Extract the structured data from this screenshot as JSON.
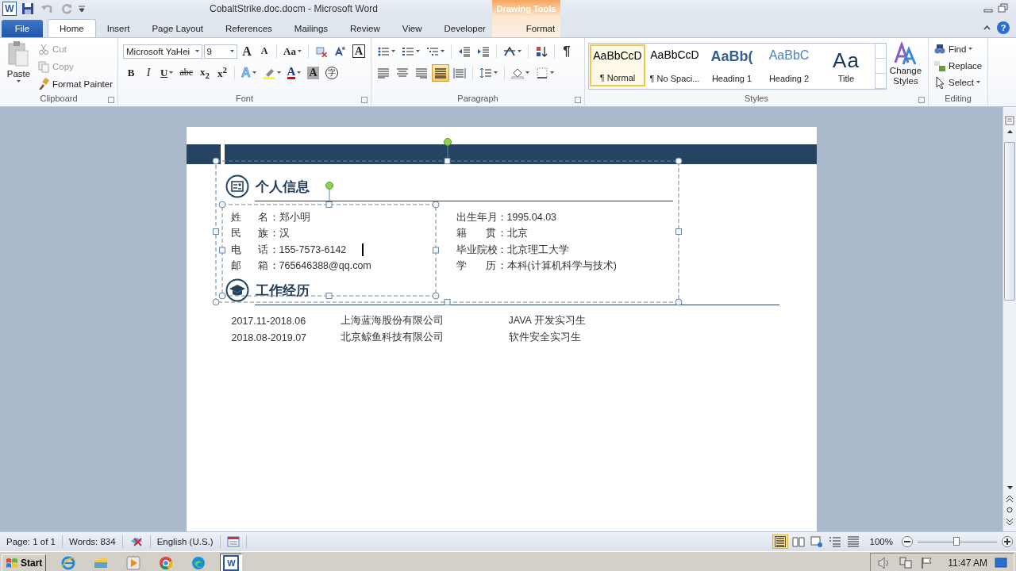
{
  "title_bar": {
    "app_icon": "W",
    "title": "CobaltStrike.doc.docm - Microsoft Word",
    "context_tab": "Drawing Tools",
    "help": "?"
  },
  "tabs": [
    {
      "label": "File",
      "kind": "file",
      "selected": false
    },
    {
      "label": "Home",
      "kind": "tab",
      "selected": true
    },
    {
      "label": "Insert",
      "kind": "tab",
      "selected": false
    },
    {
      "label": "Page Layout",
      "kind": "tab",
      "selected": false
    },
    {
      "label": "References",
      "kind": "tab",
      "selected": false
    },
    {
      "label": "Mailings",
      "kind": "tab",
      "selected": false
    },
    {
      "label": "Review",
      "kind": "tab",
      "selected": false
    },
    {
      "label": "View",
      "kind": "tab",
      "selected": false
    },
    {
      "label": "Developer",
      "kind": "tab",
      "selected": false
    },
    {
      "label": "Format",
      "kind": "context",
      "selected": false
    }
  ],
  "clipboard": {
    "label": "Clipboard",
    "paste": "Paste",
    "items": [
      {
        "kind": "cut",
        "label": "Cut",
        "disabled": true
      },
      {
        "kind": "copy",
        "label": "Copy",
        "disabled": true
      },
      {
        "kind": "brush",
        "label": "Format Painter",
        "disabled": false
      }
    ]
  },
  "font": {
    "label": "Font",
    "name": "Microsoft YaHei",
    "size": "9",
    "row1": [
      {
        "kind": "grow",
        "label": "A"
      },
      {
        "kind": "shrink",
        "label": "A"
      },
      {
        "kind": "case",
        "label": "Aa"
      },
      {
        "kind": "clear"
      },
      {
        "kind": "phonetic"
      },
      {
        "kind": "border",
        "label": "A"
      }
    ],
    "row2": [
      {
        "kind": "bold",
        "label": "B"
      },
      {
        "kind": "italic",
        "label": "I"
      },
      {
        "kind": "underline",
        "label": "U"
      },
      {
        "kind": "strike",
        "label": "abc"
      },
      {
        "kind": "sub",
        "label": "x$_{2}$"
      },
      {
        "kind": "sup",
        "label": "x$^{2}$"
      },
      {
        "kind": "effects",
        "label": "A"
      },
      {
        "kind": "highlight"
      },
      {
        "kind": "color",
        "label": "A"
      },
      {
        "kind": "shading",
        "label": "A"
      },
      {
        "kind": "enclose",
        "label": "字"
      }
    ]
  },
  "paragraph": {
    "label": "Paragraph",
    "row1": [
      {
        "kind": "bullets"
      },
      {
        "kind": "numbering"
      },
      {
        "kind": "multilevel"
      },
      {
        "kind": "outdent"
      },
      {
        "kind": "indent"
      },
      {
        "kind": "asian"
      },
      {
        "kind": "sort"
      },
      {
        "kind": "marks",
        "label": "¶"
      }
    ],
    "row2": [
      {
        "kind": "left",
        "selected": false
      },
      {
        "kind": "center",
        "selected": false
      },
      {
        "kind": "right",
        "selected": false
      },
      {
        "kind": "justify",
        "selected": true
      },
      {
        "kind": "distributed",
        "selected": false
      },
      {
        "kind": "spacing",
        "selected": false
      },
      {
        "kind": "fill",
        "selected": false
      },
      {
        "kind": "borders",
        "selected": false
      }
    ]
  },
  "styles": {
    "label": "Styles",
    "change": "Change Styles",
    "items": [
      {
        "sample": "AaBbCcD",
        "name": "¶ Normal",
        "kind": "normal",
        "selected": true
      },
      {
        "sample": "AaBbCcD",
        "name": "¶ No Spaci...",
        "kind": "normal",
        "selected": false
      },
      {
        "sample": "AaBb(",
        "name": "Heading 1",
        "kind": "heading1",
        "selected": false
      },
      {
        "sample": "AaBbC",
        "name": "Heading 2",
        "kind": "heading2",
        "selected": false
      },
      {
        "sample": "Aa",
        "name": "Title",
        "kind": "title",
        "selected": false
      }
    ]
  },
  "editing": {
    "label": "Editing",
    "items": [
      {
        "kind": "find",
        "label": "Find"
      },
      {
        "kind": "replace",
        "label": "Replace"
      },
      {
        "kind": "select",
        "label": "Select"
      }
    ]
  },
  "document": {
    "info": {
      "title": "个人信息",
      "selected": true,
      "left": {
        "selected": true,
        "fields": [
          {
            "label": "姓 名",
            "value": "：郑小明",
            "caret": false
          },
          {
            "label": "民 族",
            "value": "：汉",
            "caret": false
          },
          {
            "label": "电 话",
            "value": "：155-7573-6142",
            "caret": true
          },
          {
            "label": "邮 箱",
            "value": "：765646388@qq.com",
            "caret": false
          }
        ]
      },
      "right": {
        "fields": [
          {
            "label": "出生年月",
            "value": "：1995.04.03"
          },
          {
            "label": "籍 贯",
            "value": "：北京"
          },
          {
            "label": "毕业院校",
            "value": "：北京理工大学"
          },
          {
            "label": "学 历",
            "value": "：本科(计算机科学与技术)"
          }
        ]
      }
    },
    "work": {
      "title": "工作经历",
      "rows": [
        {
          "period": "2017.11-2018.06",
          "company": "上海蓝海股份有限公司",
          "role": "JAVA 开发实习生"
        },
        {
          "period": "2018.08-2019.07",
          "company": "北京鲸鱼科技有限公司",
          "role": "软件安全实习生"
        }
      ]
    }
  },
  "status_bar": {
    "page": "Page: 1 of 1",
    "words": "Words: 834",
    "language": "English (U.S.)",
    "views": [
      {
        "kind": "print",
        "selected": true
      },
      {
        "kind": "reading",
        "selected": false
      },
      {
        "kind": "web",
        "selected": false
      },
      {
        "kind": "outline",
        "selected": false
      },
      {
        "kind": "draft",
        "selected": false
      }
    ],
    "zoom": "100%",
    "zoom_slider": {
      "level": 0.5
    }
  },
  "taskbar": {
    "start": "Start",
    "apps": [
      {
        "kind": "ie",
        "selected": false
      },
      {
        "kind": "folder",
        "selected": false
      },
      {
        "kind": "media",
        "selected": false
      },
      {
        "kind": "chrome",
        "selected": false
      },
      {
        "kind": "edge",
        "selected": false
      },
      {
        "kind": "word",
        "label": "W",
        "selected": true
      }
    ],
    "tray": [
      {
        "kind": "speaker"
      },
      {
        "kind": "network"
      },
      {
        "kind": "flag"
      }
    ],
    "clock": "11:47 AM"
  }
}
